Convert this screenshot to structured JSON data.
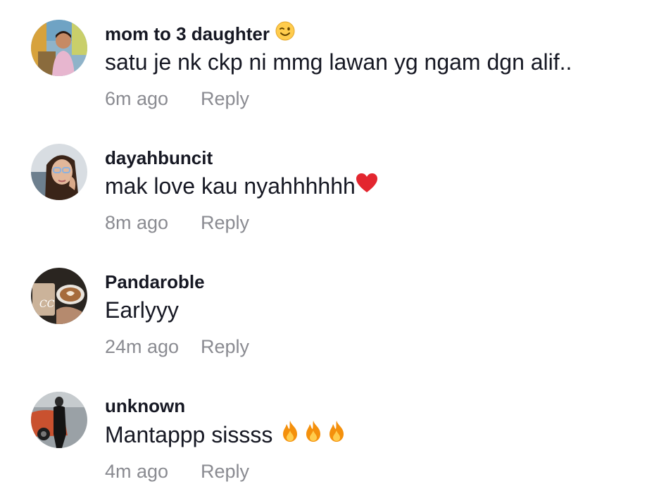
{
  "comments": [
    {
      "username": "mom to 3 daughter",
      "username_emoji": "winking-face-emoji",
      "text": "satu je nk ckp ni mmg lawan yg ngam dgn alif..",
      "time": "6m ago",
      "reply_label": "Reply",
      "avatar": "child-photo-avatar"
    },
    {
      "username": "dayahbuncit",
      "text": "mak love kau nyahhhhhh",
      "text_emoji": "red-heart-emoji",
      "time": "8m ago",
      "reply_label": "Reply",
      "avatar": "woman-glasses-avatar"
    },
    {
      "username": "Pandaroble",
      "text": "Earlyyy",
      "time": "24m ago",
      "reply_label": "Reply",
      "avatar": "coffee-cups-avatar"
    },
    {
      "username": "unknown",
      "text": "Mantappp sissss",
      "text_emoji": "fire-emoji x3",
      "time": "4m ago",
      "reply_label": "Reply",
      "avatar": "person-with-car-avatar"
    }
  ],
  "colors": {
    "username": "#161823",
    "text": "#161823",
    "meta": "#8a8b91",
    "background": "#ffffff"
  }
}
